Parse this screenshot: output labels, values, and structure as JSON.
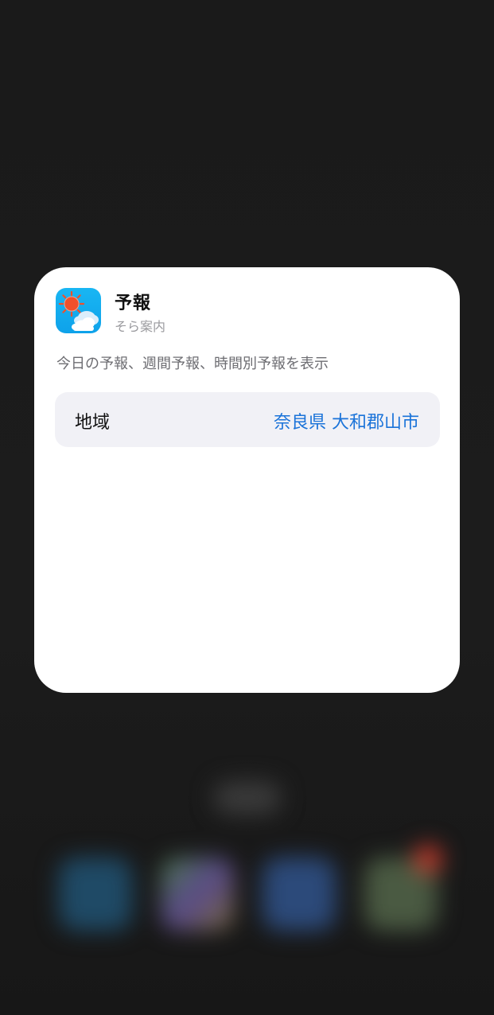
{
  "widget": {
    "app_name": "予報",
    "app_subtitle": "そら案内",
    "description": "今日の予報、週間予報、時間別予報を表示",
    "app_icon": "sun-cloud-icon"
  },
  "parameter": {
    "label": "地域",
    "value": "奈良県 大和郡山市"
  },
  "colors": {
    "accent": "#1a73d9",
    "icon_background": "#0ea2ea",
    "sun": "#f0502c",
    "card": "#ffffff",
    "row_background": "#f1f1f6"
  }
}
